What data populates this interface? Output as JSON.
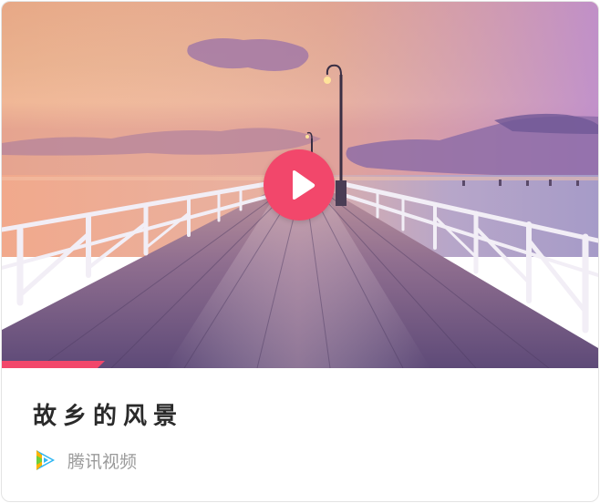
{
  "video": {
    "title": "故乡的风景",
    "progress_fraction": 0.16
  },
  "source": {
    "label": "腾讯视频",
    "icon": "tencent-video-logo-icon"
  },
  "cover": {
    "description_icon": "play-icon"
  },
  "colors": {
    "accent": "#f2476b",
    "title_text": "#2a2a2a",
    "source_text": "#9a9a9a",
    "border": "#e3e3e3"
  }
}
